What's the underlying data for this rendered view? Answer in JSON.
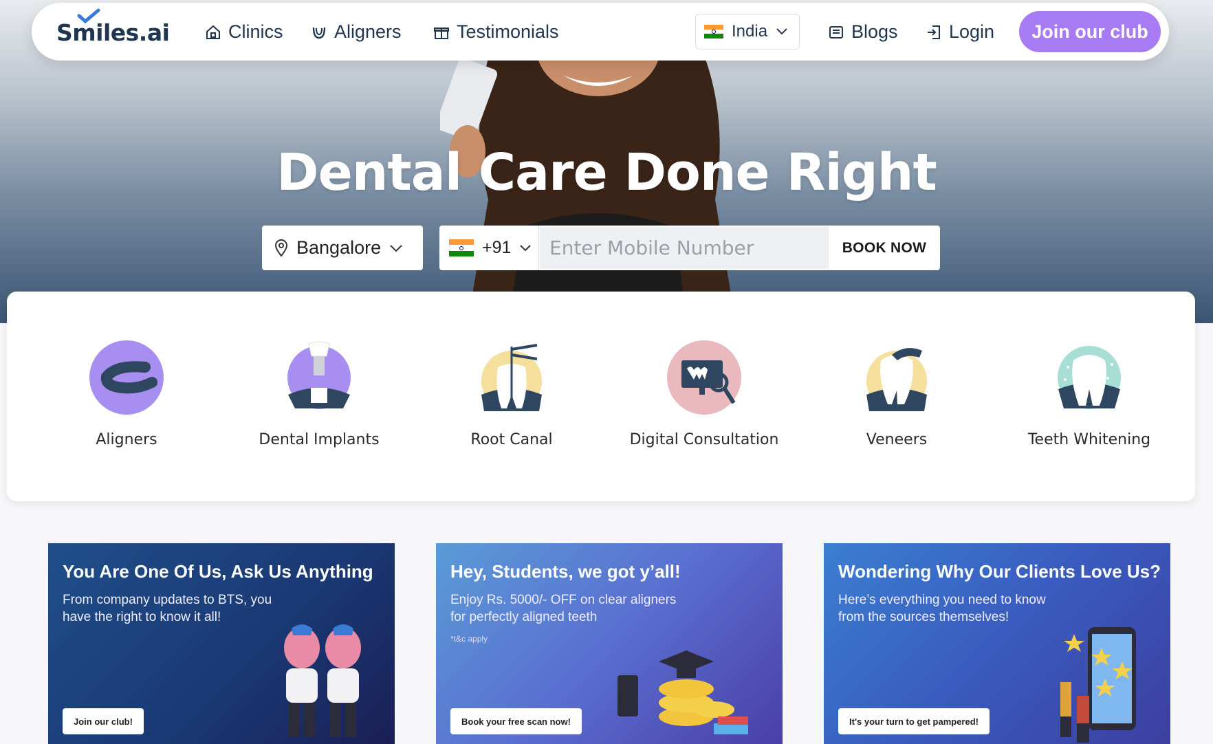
{
  "nav": {
    "logo": "Smiles.ai",
    "links": [
      {
        "label": "Clinics",
        "icon": "home-icon"
      },
      {
        "label": "Aligners",
        "icon": "aligner-icon"
      },
      {
        "label": "Testimonials",
        "icon": "gift-icon"
      }
    ],
    "country": "India",
    "blogs": "Blogs",
    "login": "Login",
    "join": "Join our club"
  },
  "hero": {
    "title": "Dental Care Done Right"
  },
  "booking": {
    "city": "Bangalore",
    "country_code": "+91",
    "mobile_placeholder": "Enter Mobile Number",
    "book_label": "BOOK NOW"
  },
  "services": [
    {
      "label": "Aligners",
      "icon": "aligner-icon"
    },
    {
      "label": "Dental Implants",
      "icon": "implant-icon"
    },
    {
      "label": "Root Canal",
      "icon": "root-canal-icon"
    },
    {
      "label": "Digital Consultation",
      "icon": "monitor-icon"
    },
    {
      "label": "Veneers",
      "icon": "veneer-icon"
    },
    {
      "label": "Teeth Whitening",
      "icon": "tooth-sparkle-icon"
    }
  ],
  "promos": [
    {
      "title": "You Are One Of Us, Ask Us Anything",
      "desc": "From company updates to BTS, you have the right to know it all!",
      "button": "Join our club!"
    },
    {
      "title": "Hey, Students, we got y’all!",
      "desc": "Enjoy Rs. 5000/- OFF on clear aligners for perfectly aligned teeth",
      "tnc": "*t&c apply",
      "button": "Book your free scan now!"
    },
    {
      "title": "Wondering Why Our Clients Love Us?",
      "desc": "Here’s everything you need to know from the sources themselves!",
      "button": "It's your turn to get pampered!"
    }
  ],
  "colors": {
    "brand_navy": "#1f3550",
    "accent_purple": "#a77bf3"
  }
}
